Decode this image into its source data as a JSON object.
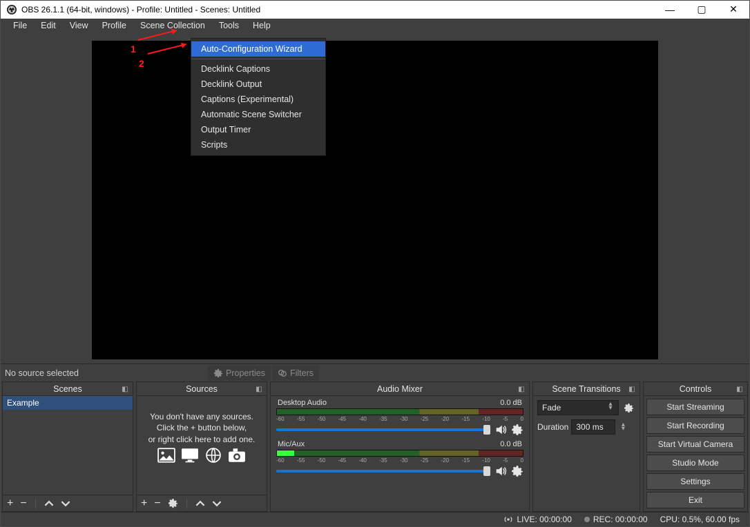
{
  "title": "OBS 26.1.1 (64-bit, windows) - Profile: Untitled - Scenes: Untitled",
  "menubar": [
    "File",
    "Edit",
    "View",
    "Profile",
    "Scene Collection",
    "Tools",
    "Help"
  ],
  "tools_menu": {
    "highlighted": "Auto-Configuration Wizard",
    "items": [
      "Decklink Captions",
      "Decklink Output",
      "Captions (Experimental)",
      "Automatic Scene Switcher",
      "Output Timer",
      "Scripts"
    ]
  },
  "annotations": {
    "one": "1",
    "two": "2"
  },
  "midbar": {
    "status": "No source selected",
    "properties": "Properties",
    "filters": "Filters"
  },
  "panels": {
    "scenes": {
      "title": "Scenes",
      "items": [
        "Example"
      ]
    },
    "sources": {
      "title": "Sources",
      "help1": "You don't have any sources.",
      "help2": "Click the + button below,",
      "help3": "or right click here to add one."
    },
    "mixer": {
      "title": "Audio Mixer",
      "tracks": [
        {
          "name": "Desktop Audio",
          "db": "0.0 dB"
        },
        {
          "name": "Mic/Aux",
          "db": "0.0 dB"
        }
      ],
      "ticks": [
        "-60",
        "-55",
        "-50",
        "-45",
        "-40",
        "-35",
        "-30",
        "-25",
        "-20",
        "-15",
        "-10",
        "-5",
        "0"
      ]
    },
    "transitions": {
      "title": "Scene Transitions",
      "selected": "Fade",
      "duration_label": "Duration",
      "duration_value": "300 ms"
    },
    "controls": {
      "title": "Controls",
      "buttons": [
        "Start Streaming",
        "Start Recording",
        "Start Virtual Camera",
        "Studio Mode",
        "Settings",
        "Exit"
      ]
    }
  },
  "status": {
    "live": "LIVE: 00:00:00",
    "rec": "REC: 00:00:00",
    "cpu": "CPU: 0.5%, 60.00 fps"
  }
}
